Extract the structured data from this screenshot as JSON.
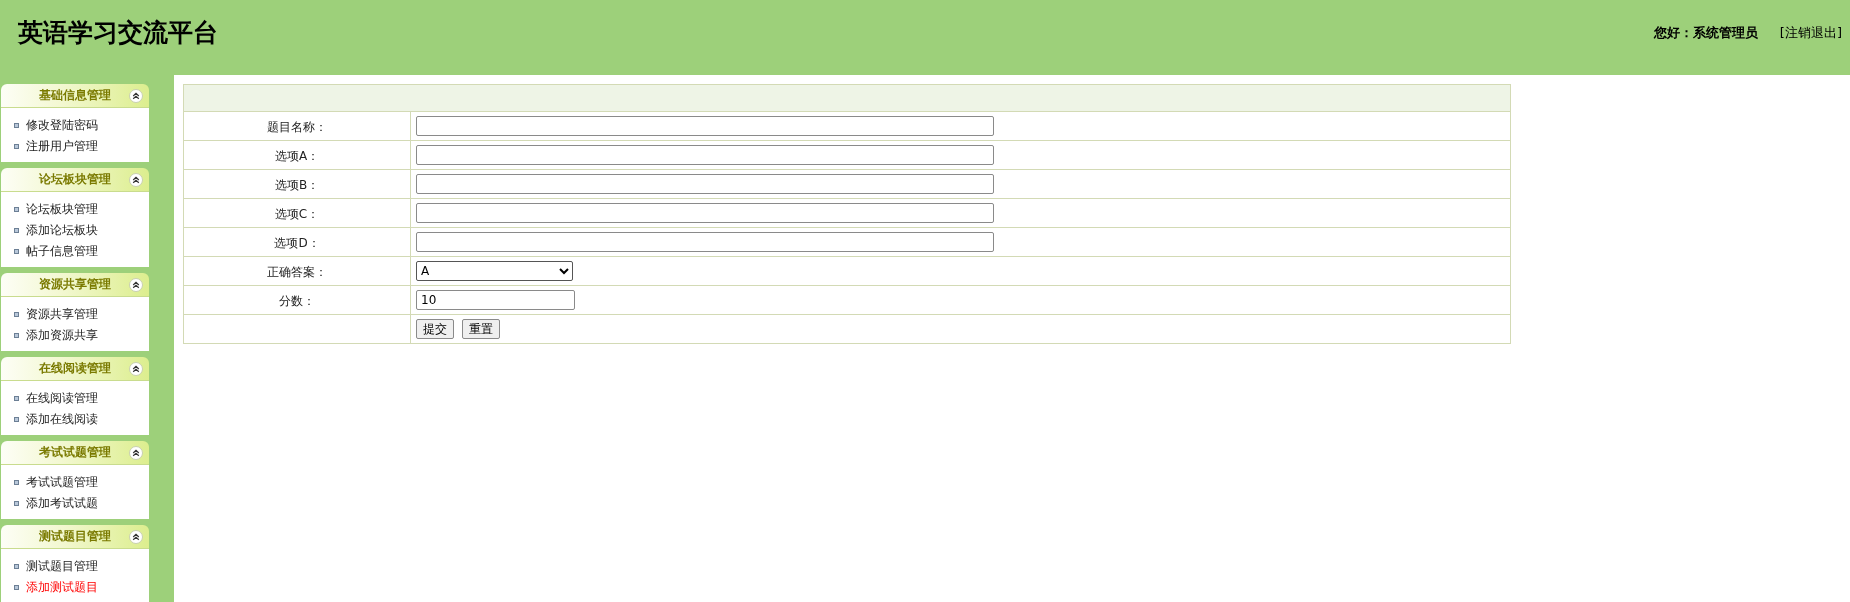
{
  "header": {
    "title": "英语学习交流平台",
    "greeting": "您好：系统管理员",
    "logout_link": "[注销退出]"
  },
  "sidebar": {
    "groups": [
      {
        "title": "基础信息管理",
        "expanded": true,
        "items": [
          {
            "label": "修改登陆密码",
            "selected": false
          },
          {
            "label": "注册用户管理",
            "selected": false
          }
        ]
      },
      {
        "title": "论坛板块管理",
        "expanded": true,
        "items": [
          {
            "label": "论坛板块管理",
            "selected": false
          },
          {
            "label": "添加论坛板块",
            "selected": false
          },
          {
            "label": "帖子信息管理",
            "selected": false
          }
        ]
      },
      {
        "title": "资源共享管理",
        "expanded": true,
        "items": [
          {
            "label": "资源共享管理",
            "selected": false
          },
          {
            "label": "添加资源共享",
            "selected": false
          }
        ]
      },
      {
        "title": "在线阅读管理",
        "expanded": true,
        "items": [
          {
            "label": "在线阅读管理",
            "selected": false
          },
          {
            "label": "添加在线阅读",
            "selected": false
          }
        ]
      },
      {
        "title": "考试试题管理",
        "expanded": true,
        "items": [
          {
            "label": "考试试题管理",
            "selected": false
          },
          {
            "label": "添加考试试题",
            "selected": false
          }
        ]
      },
      {
        "title": "测试题目管理",
        "expanded": true,
        "items": [
          {
            "label": "测试题目管理",
            "selected": false
          },
          {
            "label": "添加测试题目",
            "selected": true
          }
        ]
      }
    ]
  },
  "form": {
    "fields": [
      {
        "kind": "text",
        "label": "题目名称："
      },
      {
        "kind": "text",
        "label": "选项A："
      },
      {
        "kind": "text",
        "label": "选项B："
      },
      {
        "kind": "text",
        "label": "选项C："
      },
      {
        "kind": "text",
        "label": "选项D："
      },
      {
        "kind": "select",
        "label": "正确答案：",
        "value": "A"
      },
      {
        "kind": "number",
        "label": "分数：",
        "value": "10"
      }
    ],
    "buttons": [
      "提交",
      "重置"
    ]
  }
}
